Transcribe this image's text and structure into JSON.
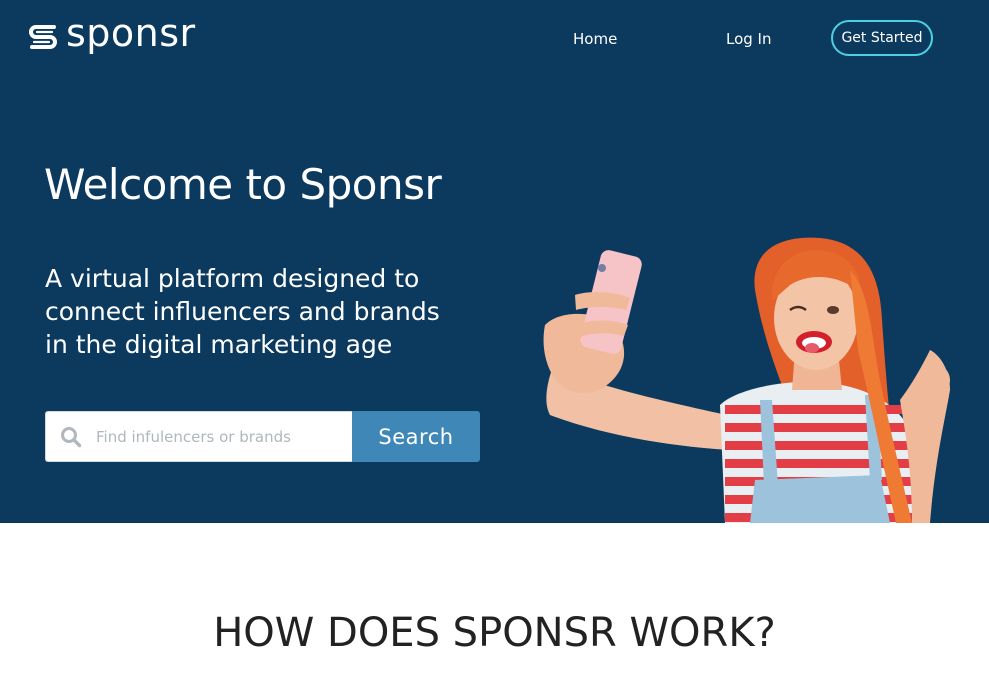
{
  "brand": {
    "name": "sponsr",
    "accent": "#4dd0e1",
    "hero_bg": "#0c3a5f",
    "button_bg": "#3f87b6"
  },
  "nav": {
    "home": "Home",
    "login": "Log In",
    "get_started": "Get Started"
  },
  "hero": {
    "title": "Welcome to Sponsr",
    "subtitle_lines": [
      "A virtual platform designed to",
      "connect influencers and brands",
      "in the digital marketing age"
    ]
  },
  "search": {
    "placeholder": "Find infulencers or brands",
    "button_label": "Search",
    "icon": "search-icon"
  },
  "section": {
    "title": "HOW DOES SPONSR WORK?"
  }
}
